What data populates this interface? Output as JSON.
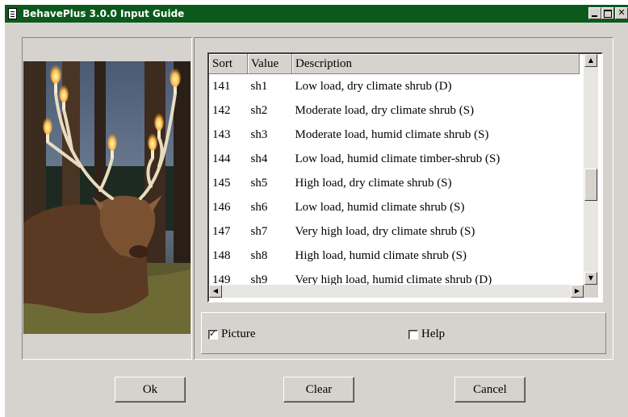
{
  "window": {
    "title": "BehavePlus 3.0.0 Input Guide"
  },
  "table": {
    "headers": {
      "sort": "Sort",
      "value": "Value",
      "description": "Description"
    },
    "rows": [
      {
        "sort": "141",
        "value": "sh1",
        "description": "Low load, dry climate shrub (D)"
      },
      {
        "sort": "142",
        "value": "sh2",
        "description": "Moderate load, dry climate shrub (S)"
      },
      {
        "sort": "143",
        "value": "sh3",
        "description": "Moderate load, humid climate shrub (S)"
      },
      {
        "sort": "144",
        "value": "sh4",
        "description": "Low load, humid climate timber-shrub (S)"
      },
      {
        "sort": "145",
        "value": "sh5",
        "description": "High load, dry climate shrub (S)"
      },
      {
        "sort": "146",
        "value": "sh6",
        "description": "Low load, humid climate shrub (S)"
      },
      {
        "sort": "147",
        "value": "sh7",
        "description": "Very high load, dry climate shrub (S)"
      },
      {
        "sort": "148",
        "value": "sh8",
        "description": "High load, humid climate shrub (S)"
      },
      {
        "sort": "149",
        "value": "sh9",
        "description": "Very high load, humid climate shrub (D)"
      }
    ]
  },
  "options": {
    "picture": {
      "label": "Picture",
      "checked": true
    },
    "help": {
      "label": "Help",
      "checked": false
    }
  },
  "buttons": {
    "ok": "Ok",
    "clear": "Clear",
    "cancel": "Cancel"
  },
  "colors": {
    "titlebar": "#0b5a1c",
    "face": "#d6d3ce"
  }
}
